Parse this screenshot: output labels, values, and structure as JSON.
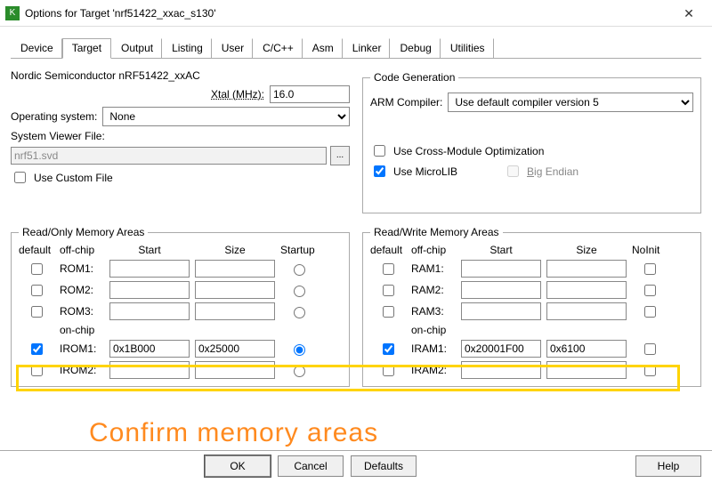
{
  "window": {
    "title": "Options for Target 'nrf51422_xxac_s130'"
  },
  "tabs": [
    "Device",
    "Target",
    "Output",
    "Listing",
    "User",
    "C/C++",
    "Asm",
    "Linker",
    "Debug",
    "Utilities"
  ],
  "active_tab": "Target",
  "device_line": "Nordic Semiconductor nRF51422_xxAC",
  "xtal": {
    "label": "Xtal (MHz):",
    "value": "16.0"
  },
  "operating_system": {
    "label": "Operating system:",
    "value": "None"
  },
  "system_viewer": {
    "label": "System Viewer File:",
    "value": "nrf51.svd"
  },
  "use_custom_file": {
    "label": "Use Custom File",
    "checked": false
  },
  "code_gen": {
    "legend": "Code Generation",
    "arm_compiler_label": "ARM Compiler:",
    "arm_compiler_value": "Use default compiler version 5",
    "cross_module": {
      "label": "Use Cross-Module Optimization",
      "checked": false
    },
    "microlib": {
      "label": "Use MicroLIB",
      "checked": true
    },
    "big_endian": {
      "label": "Big Endian",
      "checked": false,
      "enabled": false
    }
  },
  "rom": {
    "legend": "Read/Only Memory Areas",
    "headers": {
      "default": "default",
      "offchip": "off-chip",
      "start": "Start",
      "size": "Size",
      "startup": "Startup",
      "onchip": "on-chip"
    },
    "rows": [
      {
        "name": "ROM1:",
        "def": false,
        "start": "",
        "size": "",
        "startup": false
      },
      {
        "name": "ROM2:",
        "def": false,
        "start": "",
        "size": "",
        "startup": false
      },
      {
        "name": "ROM3:",
        "def": false,
        "start": "",
        "size": "",
        "startup": false
      }
    ],
    "onchip_rows": [
      {
        "name": "IROM1:",
        "def": true,
        "start": "0x1B000",
        "size": "0x25000",
        "startup": true
      },
      {
        "name": "IROM2:",
        "def": false,
        "start": "",
        "size": "",
        "startup": false
      }
    ]
  },
  "ram": {
    "legend": "Read/Write Memory Areas",
    "headers": {
      "default": "default",
      "offchip": "off-chip",
      "start": "Start",
      "size": "Size",
      "noinit": "NoInit",
      "onchip": "on-chip"
    },
    "rows": [
      {
        "name": "RAM1:",
        "def": false,
        "start": "",
        "size": "",
        "noinit": false
      },
      {
        "name": "RAM2:",
        "def": false,
        "start": "",
        "size": "",
        "noinit": false
      },
      {
        "name": "RAM3:",
        "def": false,
        "start": "",
        "size": "",
        "noinit": false
      }
    ],
    "onchip_rows": [
      {
        "name": "IRAM1:",
        "def": true,
        "start": "0x20001F00",
        "size": "0x6100",
        "noinit": false
      },
      {
        "name": "IRAM2:",
        "def": false,
        "start": "",
        "size": "",
        "noinit": false
      }
    ]
  },
  "buttons": {
    "ok": "OK",
    "cancel": "Cancel",
    "defaults": "Defaults",
    "help": "Help"
  },
  "annotation": "Confirm memory areas"
}
